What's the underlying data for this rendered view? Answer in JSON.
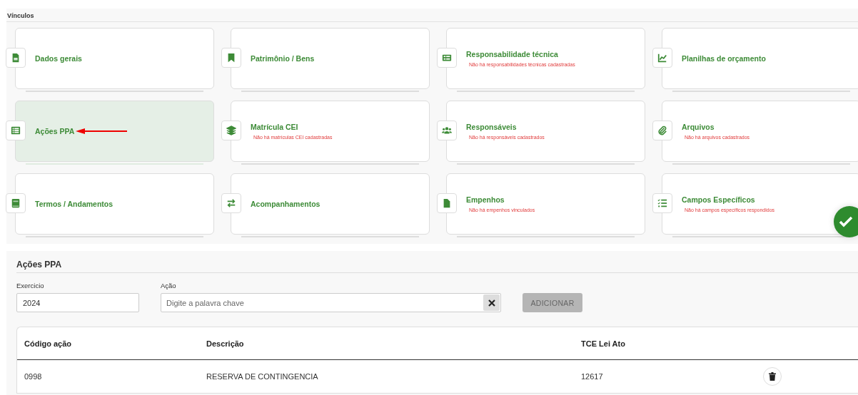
{
  "vinculos": {
    "title": "Vínculos",
    "cards": [
      {
        "title": "Dados gerais",
        "selected": false
      },
      {
        "title": "Patrimônio / Bens",
        "selected": false
      },
      {
        "title": "Responsabilidade técnica",
        "message": "Não há responsabilidades técnicas cadastradas",
        "selected": false
      },
      {
        "title": "Planilhas de orçamento",
        "selected": false
      },
      {
        "title": "Ações PPA",
        "selected": true
      },
      {
        "title": "Matrícula CEI",
        "message": "Não há matrículas CEI cadastradas",
        "selected": false
      },
      {
        "title": "Responsáveis",
        "message": "Não há responsáveis cadastrados",
        "selected": false
      },
      {
        "title": "Arquivos",
        "message": "Não há arquivos cadastrados",
        "selected": false
      },
      {
        "title": "Termos / Andamentos",
        "selected": false
      },
      {
        "title": "Acompanhamentos",
        "selected": false
      },
      {
        "title": "Empenhos",
        "message": "Não há empenhos vinculados",
        "selected": false
      },
      {
        "title": "Campos Específicos",
        "message": "Não há campos específicos respondidos",
        "selected": false
      }
    ]
  },
  "acoes_ppa": {
    "title": "Ações PPA",
    "exercicio": {
      "label": "Exercicio",
      "value": "2024"
    },
    "acao": {
      "label": "Ação",
      "placeholder": "Digite a palavra chave"
    },
    "add_button": {
      "label": "ADICIONAR",
      "disabled": true
    },
    "table": {
      "columns": [
        "Código ação",
        "Descrição",
        "TCE Lei Ato"
      ],
      "rows": [
        {
          "cells": [
            "0998",
            "RESERVA DE CONTINGENCIA",
            "12617"
          ]
        }
      ]
    }
  }
}
